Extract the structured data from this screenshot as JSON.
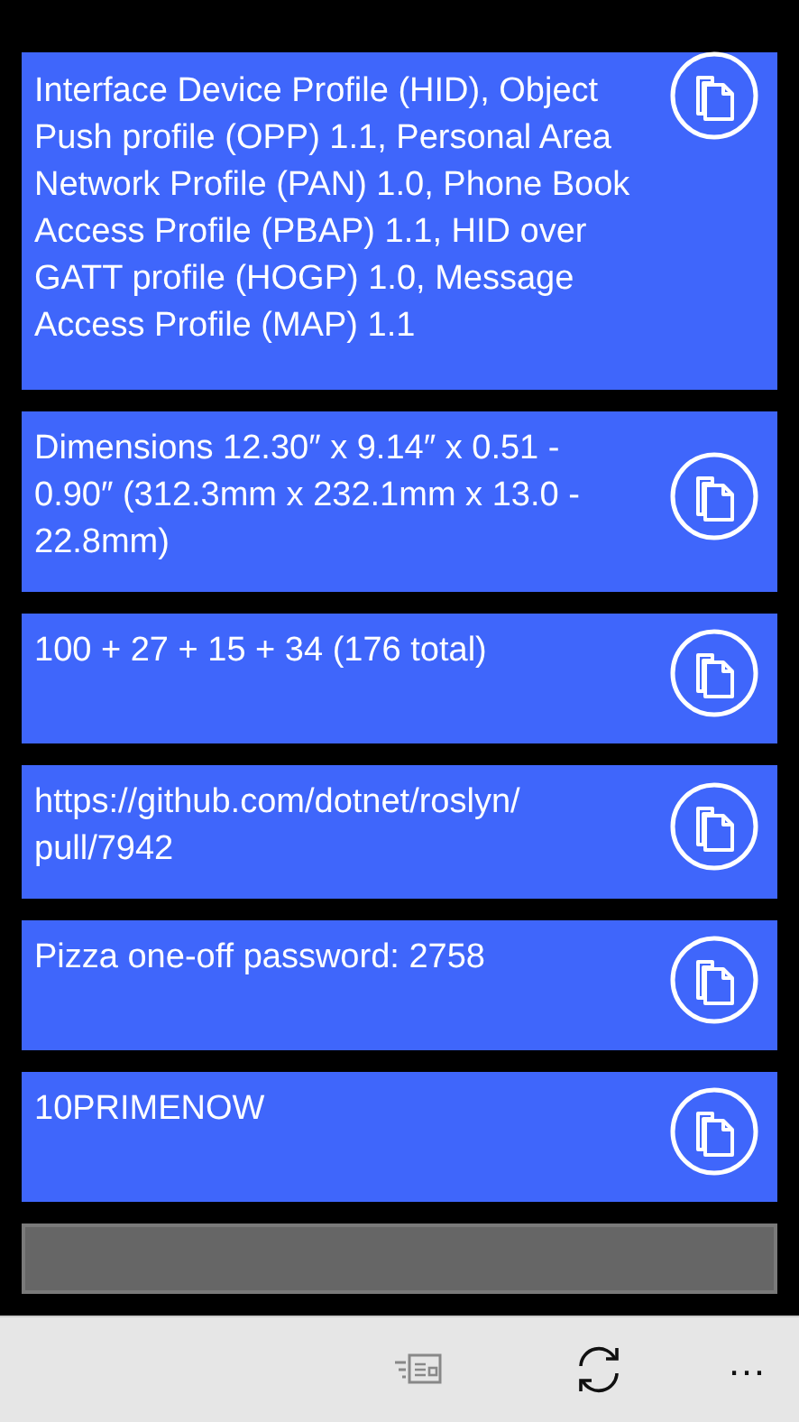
{
  "clips": [
    {
      "text": "Interface Device Profile (HID), Object Push profile (OPP) 1.1, Personal Area Network Profile (PAN) 1.0, Phone Book Access Profile (PBAP) 1.1, HID over GATT profile (HOGP) 1.0, Message Access Profile (MAP) 1.1",
      "cut_top": true
    },
    {
      "text": "Dimensions 12.30″ x 9.14″ x 0.51 - 0.90″ (312.3mm x 232.1mm x 13.0 - 22.8mm)",
      "cut_top": false
    },
    {
      "text": "100 + 27 + 15 + 34 (176 total)",
      "cut_top": false
    },
    {
      "text": "https://github.com/dotnet/roslyn/ pull/7942",
      "cut_top": false
    },
    {
      "text": "Pizza one-off password: 2758",
      "cut_top": false
    },
    {
      "text": "10PRIMENOW",
      "cut_top": false
    }
  ],
  "app_bar": {
    "buttons": [
      {
        "kind": "feed",
        "disabled": true
      },
      {
        "kind": "refresh",
        "disabled": false
      }
    ],
    "more": "…"
  }
}
